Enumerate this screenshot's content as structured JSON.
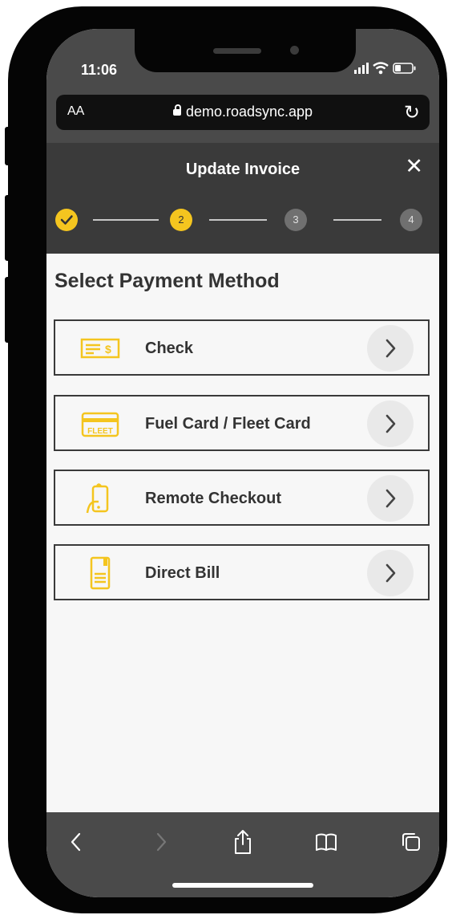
{
  "status_bar": {
    "time": "11:06",
    "icons": "wifi-signal-battery"
  },
  "browser": {
    "text_size_label": "AA",
    "url": "demo.roadsync.app"
  },
  "header": {
    "title": "Update Invoice",
    "close_icon": "close-icon"
  },
  "stepper": {
    "steps": [
      {
        "label": "",
        "state": "done"
      },
      {
        "label": "2",
        "state": "current"
      },
      {
        "label": "3",
        "state": "pending"
      },
      {
        "label": "4",
        "state": "pending"
      }
    ]
  },
  "content": {
    "section_title": "Select Payment Method",
    "methods": [
      {
        "label": "Check",
        "icon": "check-payment-icon"
      },
      {
        "label": "Fuel Card / Fleet Card",
        "icon": "fleet-card-icon",
        "icon_text": "FLEET"
      },
      {
        "label": "Remote Checkout",
        "icon": "remote-checkout-icon"
      },
      {
        "label": "Direct Bill",
        "icon": "document-icon"
      }
    ]
  },
  "colors": {
    "accent": "#F4C51F",
    "header_bg": "#3A3A3A",
    "toolbar_bg": "#4A4A4A",
    "page_bg": "#F7F7F7"
  }
}
